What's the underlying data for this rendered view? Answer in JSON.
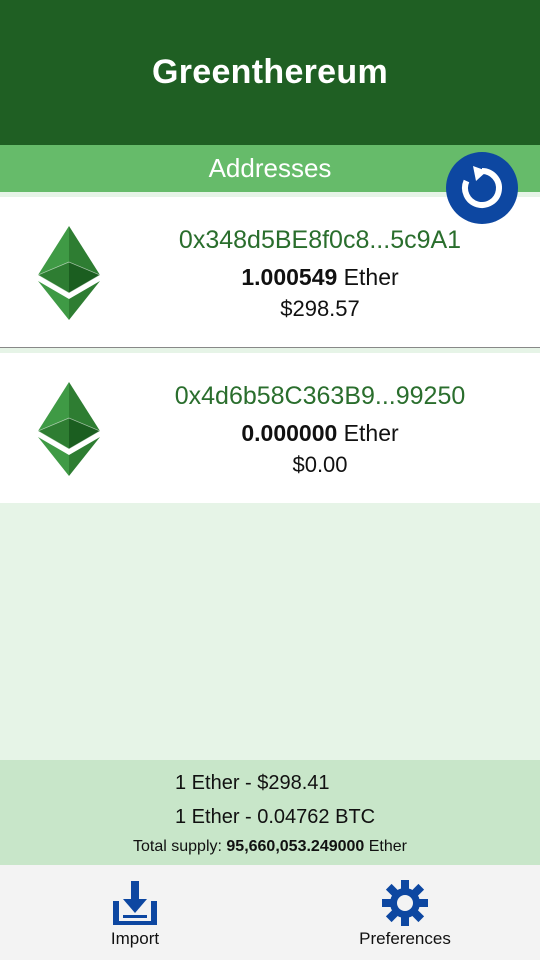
{
  "app": {
    "title": "Greenthereum"
  },
  "section": {
    "title": "Addresses"
  },
  "addresses": [
    {
      "address": "0x348d5BE8f0c8...5c9A1",
      "amount": "1.000549",
      "unit": " Ether",
      "usd": "$298.57"
    },
    {
      "address": "0x4d6b58C363B9...99250",
      "amount": "0.000000",
      "unit": " Ether",
      "usd": "$0.00"
    }
  ],
  "stats": {
    "price_usd": "1 Ether - $298.41",
    "price_btc": "1 Ether - 0.04762 BTC",
    "supply_label": "Total supply: ",
    "supply_value": "95,660,053.249000",
    "supply_unit": " Ether"
  },
  "nav": {
    "import_label": "Import",
    "preferences_label": "Preferences"
  },
  "icons": {
    "refresh": "refresh-icon",
    "eth": "ethereum-icon",
    "import": "download-tray-icon",
    "preferences": "gear-icon"
  },
  "colors": {
    "header": "#1f5f23",
    "subheader": "#66bb6a",
    "address_text": "#2a6e2d",
    "accent_blue": "#0d47a1",
    "background": "#e6f4e7",
    "stats_background": "#c8e6c9"
  }
}
